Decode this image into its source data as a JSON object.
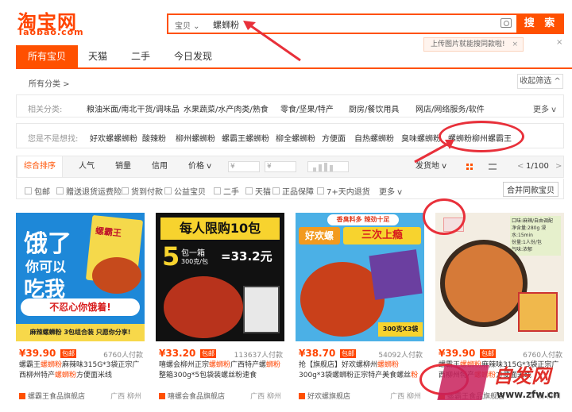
{
  "header": {
    "logo_main": "淘宝网",
    "logo_sub": "Taobao.com"
  },
  "search": {
    "scope": "宝贝",
    "query": "螺蛳粉",
    "button": "搜 索",
    "tip": "上传图片就能搜同款啦!",
    "tip_close": "×"
  },
  "corner_close": "×",
  "tabs": [
    "所有宝贝",
    "天猫",
    "二手",
    "今日发现"
  ],
  "breadcrumb": "所有分类 >",
  "collapse": "收起筛选 ^",
  "related": {
    "label": "相关分类:",
    "items": [
      "粮油米面/南北干货/调味品",
      "水果蔬菜/水产肉类/熟食",
      "零食/坚果/特产",
      "厨房/餐饮用具",
      "网店/网络服务/软件"
    ],
    "more": "更多 v"
  },
  "guess": {
    "label": "您是不是想找:",
    "items": [
      "好欢螺螺蛳粉",
      "酸辣粉",
      "柳州螺蛳粉",
      "螺霸王螺蛳粉",
      "柳全螺蛳粉",
      "方便面",
      "自热螺蛳粉",
      "臭味螺蛳粉",
      "螺蛳粉柳州螺霸王"
    ]
  },
  "sort": {
    "items": [
      "综合排序",
      "人气",
      "销量",
      "信用",
      "价格 v"
    ],
    "price_min": "¥",
    "price_max": "¥",
    "ship_from": "发货地 v",
    "page": "1/100",
    "prev": "<",
    "next": ">"
  },
  "filters": [
    "包邮",
    "赠送退货运费险",
    "货到付款",
    "公益宝贝",
    "二手",
    "天猫",
    "正品保障",
    "7+天内退货"
  ],
  "filters_more": "更多 v",
  "merge": "合并同款宝贝",
  "products": [
    {
      "price": "¥39.90",
      "badge": "包邮",
      "sold": "6760人付款",
      "title_a": "螺霸王",
      "title_hl1": "螺蛳粉",
      "title_b": "麻辣味315G*3袋正宗广西柳州特产",
      "title_hl2": "螺蛳粉",
      "title_c": "方便面米线",
      "shop": "螺霸王食品旗舰店",
      "loc": "广西 柳州",
      "img": {
        "line1": "饿了",
        "line2": "你可以",
        "line3": "吃我",
        "line4": "不忍心你饿着!",
        "band": "麻辣螺蛳粉 3包组合装 只愿你分享!",
        "pack": "螺霸王"
      }
    },
    {
      "price": "¥33.20",
      "badge": "包邮",
      "sold": "113637人付款",
      "title_a": "嘻螺会柳州正宗",
      "title_hl1": "螺蛳粉",
      "title_b": "广西特产螺",
      "title_hl2": "蛳粉",
      "title_c": "整箱300g*5包袋装螺丝粉速食",
      "shop": "嘻螺会食品旗舰店",
      "loc": "广西 柳州",
      "img": {
        "banner": "每人限购10包",
        "num": "5",
        "line2": "包一箱",
        "line3": "300克/包",
        "formula": "=33.2元"
      }
    },
    {
      "price": "¥38.70",
      "badge": "包邮",
      "sold": "54092人付款",
      "title_a": "抢【旗舰店】好欢螺柳州",
      "title_hl1": "螺蛳粉",
      "title_b": "300g*3袋螺蛳粉正宗特产美食螺丝",
      "title_hl2": "粉",
      "title_c": "",
      "shop": "好欢螺旗舰店",
      "loc": "广西 柳州",
      "img": {
        "top": "香臭料多 辣劲十足",
        "brand": "好欢螺",
        "slogan": "三次上瘾",
        "pack": "300克X3袋"
      }
    },
    {
      "price": "¥39.90",
      "badge": "包邮",
      "sold": "6760人付款",
      "title_a": "螺霸王",
      "title_hl1": "螺蛳粉",
      "title_b": "麻辣味315G*3袋正宗广西柳州特产",
      "title_hl2": "螺蛳粉",
      "title_c": "方便面米线",
      "shop": "螺霸王食品旗舰店",
      "loc": "广西 柳州",
      "img": {
        "tag": "口味:麻辣/自由调配",
        "tag2": "净含量:280g 浸水:15min",
        "tag3": "份量:1人份/包",
        "tag4": "气味:浓郁"
      }
    }
  ],
  "watermark": {
    "text": "自发网",
    "url": "www.zfw.cn"
  },
  "colors": {
    "accent": "#ff5000",
    "price": "#ff4400",
    "annotation": "#e8303a"
  }
}
